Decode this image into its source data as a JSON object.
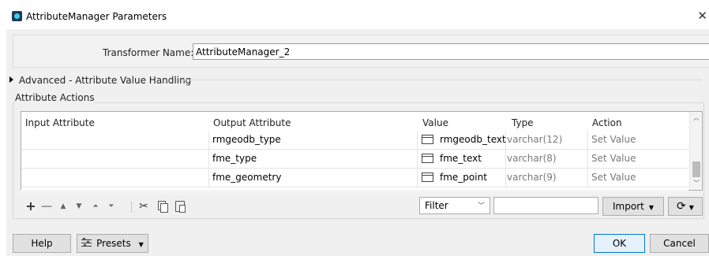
{
  "window": {
    "title": "AttributeManager Parameters",
    "close_glyph": "✕"
  },
  "transformer": {
    "label": "Transformer Name:",
    "value": "AttributeManager_2"
  },
  "advanced": {
    "label": "Advanced - Attribute Value Handling",
    "expanded": false
  },
  "actions": {
    "section_label": "Attribute Actions",
    "columns": [
      "Input Attribute",
      "Output Attribute",
      "Value",
      "Type",
      "Action"
    ],
    "rows": [
      {
        "input": "",
        "output": "rmgeodb_type",
        "value": "rmgeodb_text",
        "type": "varchar(12)",
        "action": "Set Value"
      },
      {
        "input": "",
        "output": "fme_type",
        "value": "fme_text",
        "type": "varchar(8)",
        "action": "Set Value"
      },
      {
        "input": "",
        "output": "fme_geometry",
        "value": "fme_point",
        "type": "varchar(9)",
        "action": "Set Value"
      }
    ]
  },
  "toolbar": {
    "add": "+",
    "remove": "—",
    "move_up": "▲",
    "move_down": "▼",
    "move_top": "⏶",
    "move_bottom": "⏷",
    "cut": "✂",
    "filter_value": "Filter",
    "filter_text": "",
    "import_label": "Import",
    "refresh_glyph": "⟳"
  },
  "footer": {
    "help_label": "Help",
    "presets_label": "Presets",
    "ok_label": "OK",
    "cancel_label": "Cancel"
  }
}
